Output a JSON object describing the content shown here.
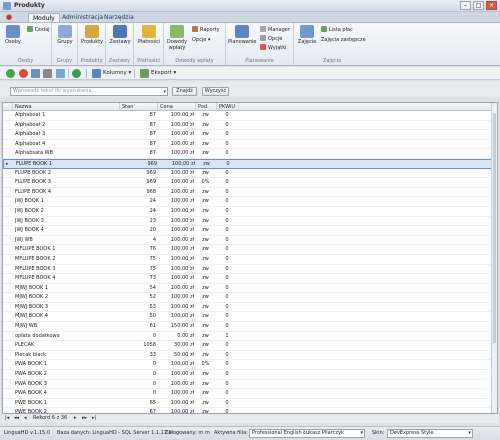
{
  "window": {
    "title": "Produkty"
  },
  "tabs": [
    {
      "label": "Moduły",
      "active": true
    },
    {
      "label": "Administracja"
    },
    {
      "label": "Narzędzia"
    }
  ],
  "ribbon": {
    "groups": [
      {
        "caption": "Osoby",
        "buttons": [
          {
            "label": "Osoby"
          }
        ],
        "small": [
          {
            "label": "Dodaj"
          }
        ]
      },
      {
        "caption": "Grupy",
        "buttons": [
          {
            "label": "Grupy"
          }
        ]
      },
      {
        "caption": "Produkty",
        "buttons": [
          {
            "label": "Produkty"
          }
        ]
      },
      {
        "caption": "Zestawy",
        "buttons": [
          {
            "label": "Zestawy"
          }
        ]
      },
      {
        "caption": "Płatności",
        "buttons": [
          {
            "label": "Płatności"
          }
        ]
      },
      {
        "caption": "Dowody wpłaty",
        "buttons": [
          {
            "label": "Dowody wpłaty"
          }
        ],
        "small": [
          {
            "label": "Raporty"
          },
          {
            "label": "Opcje ▾"
          }
        ]
      },
      {
        "caption": "Planowanie",
        "buttons": [
          {
            "label": "Planowanie"
          }
        ],
        "small": [
          {
            "label": "Manager"
          },
          {
            "label": "Opcje"
          },
          {
            "label": "Wyjątki"
          }
        ]
      },
      {
        "caption": "Zajęcia",
        "buttons": [
          {
            "label": "Zajęcia"
          }
        ],
        "small": [
          {
            "label": "Lista płac"
          },
          {
            "label": "Zajęcia zastępcze"
          }
        ]
      }
    ]
  },
  "toolbar": {
    "columns_label": "Kolumny ▾",
    "export_label": "Eksport ▾"
  },
  "search": {
    "placeholder": "Wprowadź tekst do wyszukania...",
    "find_label": "Znajdź",
    "clear_label": "Wyczyść"
  },
  "grid": {
    "columns": [
      "Nazwa",
      "Stan",
      "Cena",
      "Pod.",
      "PKWiU"
    ],
    "rows": [
      [
        "Alphaboat 1",
        "87",
        "100,00 zł",
        "zw",
        "0"
      ],
      [
        "Alphaboat 2",
        "87",
        "100,00 zł",
        "zw",
        "0"
      ],
      [
        "Alphaboat 3",
        "87",
        "100,00 zł",
        "zw",
        "0"
      ],
      [
        "Alphaboat 4",
        "87",
        "100,00 zł",
        "zw",
        "0"
      ],
      [
        "Alphabsata WB",
        "87",
        "100,00 zł",
        "zw",
        "0"
      ],
      [
        "FLUPE BOOK 1",
        "969",
        "100,00 zł",
        "zw",
        "0"
      ],
      [
        "FLUPE BOOK 2",
        "969",
        "100,00 zł",
        "zw",
        "0"
      ],
      [
        "FLUPE BOOK 3",
        "969",
        "100,00 zł",
        "0%",
        "0"
      ],
      [
        "FLUPE BOOK 4",
        "968",
        "100,00 zł",
        "zw",
        "0"
      ],
      [
        "JWJ BOOK 1",
        "24",
        "100,00 zł",
        "zw",
        "0"
      ],
      [
        "JWJ BOOK 2",
        "24",
        "100,00 zł",
        "zw",
        "0"
      ],
      [
        "JWJ BOOK 3",
        "23",
        "100,00 zł",
        "zw",
        "0"
      ],
      [
        "JWJ BOOK 4",
        "20",
        "100,00 zł",
        "zw",
        "0"
      ],
      [
        "JWJ WB",
        "4",
        "100,00 zł",
        "zw",
        "0"
      ],
      [
        "MFLUPE BOOK 1",
        "76",
        "100,00 zł",
        "zw",
        "0"
      ],
      [
        "MFLUPE BOOK 2",
        "75",
        "100,00 zł",
        "zw",
        "0"
      ],
      [
        "MFLUPE BOOK 3",
        "75",
        "100,00 zł",
        "zw",
        "0"
      ],
      [
        "MFLUPE BOOK 4",
        "73",
        "100,00 zł",
        "zw",
        "0"
      ],
      [
        "MJWJ BOOK 1",
        "54",
        "100,00 zł",
        "zw",
        "0"
      ],
      [
        "MJWJ BOOK 2",
        "52",
        "100,00 zł",
        "zw",
        "0"
      ],
      [
        "MJWJ BOOK 3",
        "53",
        "100,00 zł",
        "zw",
        "0"
      ],
      [
        "MJWJ BOOK 4",
        "50",
        "100,00 zł",
        "zw",
        "0"
      ],
      [
        "MJWJ WB",
        "61",
        "150,00 zł",
        "zw",
        "0"
      ],
      [
        "opłata dodatkowa",
        "0",
        "0,00 zł",
        "zw",
        "1"
      ],
      [
        "PLECAK",
        "1058",
        "30,00 zł",
        "zw",
        "0"
      ],
      [
        "Plecak black",
        "33",
        "50,00 zł",
        "zw",
        "0"
      ],
      [
        "PWA BOOK 1",
        "0",
        "100,00 zł",
        "0%",
        "0"
      ],
      [
        "PWA BOOK 2",
        "0",
        "100,00 zł",
        "zw",
        "0"
      ],
      [
        "PWA BOOK 3",
        "0",
        "100,00 zł",
        "zw",
        "0"
      ],
      [
        "PWA BOOK 4",
        "0",
        "100,00 zł",
        "zw",
        "0"
      ],
      [
        "PWE BOOK 1",
        "65",
        "100,00 zł",
        "zw",
        "0"
      ],
      [
        "PWE BOOK 2",
        "67",
        "100,00 zł",
        "zw",
        "0"
      ]
    ],
    "selected_row": 5
  },
  "navigator": {
    "record_text": "Rekord 6 z 36"
  },
  "status": {
    "version": "LinguaHD v.1.15.0",
    "db": "Baza danych: LinguaHD - SQL Server 1.1.17.0",
    "logged": "Zalogowany: m m",
    "branch_label": "Aktywna filia:",
    "branch_value": "Professional English Łukasz Pilarczyk",
    "skin_label": "Skin:",
    "skin_value": "DevExpress Style"
  }
}
